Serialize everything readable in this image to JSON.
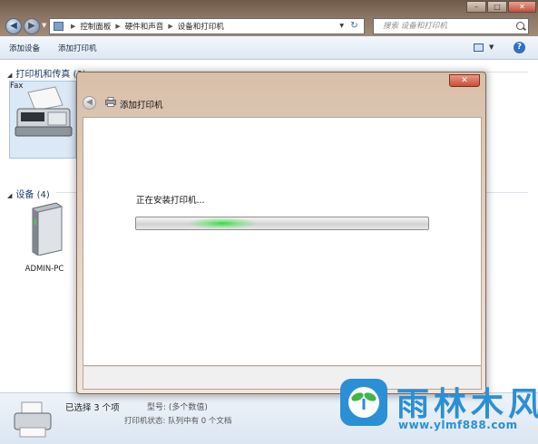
{
  "window": {
    "breadcrumb": [
      "控制面板",
      "硬件和声音",
      "设备和打印机"
    ],
    "search_placeholder": "搜索 设备和打印机"
  },
  "toolbar": {
    "add_device": "添加设备",
    "add_printer": "添加打印机"
  },
  "groups": {
    "printers": {
      "header": "打印机和传真 (3)",
      "items": [
        {
          "label": "Fax"
        }
      ]
    },
    "devices": {
      "header": "设备 (4)",
      "items": [
        {
          "label": "ADMIN-PC"
        }
      ]
    }
  },
  "statusbar": {
    "selected": "已选择 3 个项",
    "model": "型号: (多个数值)",
    "printer_status": "打印机状态: 队列中有 0 个文档"
  },
  "dialog": {
    "title": "添加打印机",
    "close_label": "✕",
    "status_text": "正在安装打印机...",
    "progress": "indeterminate"
  },
  "watermark": {
    "brand": "雨林木风",
    "url": "www.ylmf888.com"
  },
  "colors": {
    "accent": "#2b8fd6",
    "progress_glow": "#28dc3c",
    "group_header": "#1a3d6a"
  }
}
